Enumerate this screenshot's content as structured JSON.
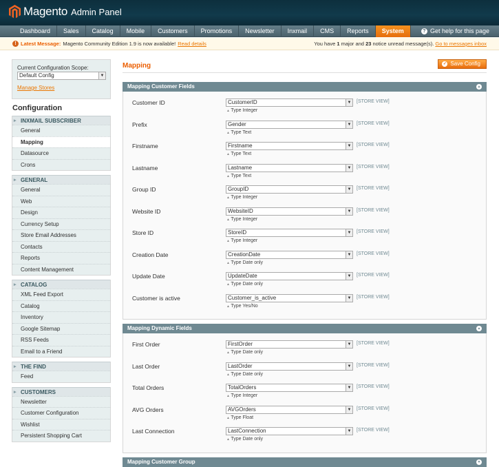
{
  "header": {
    "brand": "Magento",
    "sub": "Admin Panel",
    "help": "Get help for this page"
  },
  "nav": [
    "Dashboard",
    "Sales",
    "Catalog",
    "Mobile",
    "Customers",
    "Promotions",
    "Newsletter",
    "Inxmail",
    "CMS",
    "Reports",
    "System"
  ],
  "nav_active": "System",
  "notice": {
    "strong": "Latest Message:",
    "text": "Magento Community Edition 1.9 is now available!",
    "link": "Read details",
    "right_a": "You have ",
    "major_count": "1",
    "right_b": " major and ",
    "notice_count": "23",
    "right_c": " notice unread message(s). ",
    "right_link": "Go to messages inbox"
  },
  "scope": {
    "label": "Current Configuration Scope:",
    "value": "Default Config",
    "manage": "Manage Stores"
  },
  "config_title": "Configuration",
  "sidebar": [
    {
      "title": "INXMAIL SUBSCRIBER",
      "items": [
        "General",
        "Mapping",
        "Datasource",
        "Crons"
      ]
    },
    {
      "title": "GENERAL",
      "items": [
        "General",
        "Web",
        "Design",
        "Currency Setup",
        "Store Email Addresses",
        "Contacts",
        "Reports",
        "Content Management"
      ]
    },
    {
      "title": "CATALOG",
      "items": [
        "XML Feed Export",
        "Catalog",
        "Inventory",
        "Google Sitemap",
        "RSS Feeds",
        "Email to a Friend"
      ]
    },
    {
      "title": "THE FIND",
      "items": [
        "Feed"
      ]
    },
    {
      "title": "CUSTOMERS",
      "items": [
        "Newsletter",
        "Customer Configuration",
        "Wishlist",
        "Persistent Shopping Cart"
      ]
    }
  ],
  "sidebar_active": "Mapping",
  "page": {
    "title": "Mapping",
    "save": "Save Config"
  },
  "scope_tag": "[STORE VIEW]",
  "fieldsets": [
    {
      "title": "Mapping Customer Fields",
      "collapsed": false,
      "rows": [
        {
          "label": "Customer ID",
          "value": "CustomerID",
          "note": "Type Integer"
        },
        {
          "label": "Prefix",
          "value": "Gender",
          "note": "Type Text"
        },
        {
          "label": "Firstname",
          "value": "Firstname",
          "note": "Type Text"
        },
        {
          "label": "Lastname",
          "value": "Lastname",
          "note": "Type Text"
        },
        {
          "label": "Group ID",
          "value": "GroupID",
          "note": "Type Integer"
        },
        {
          "label": "Website ID",
          "value": "WebsiteID",
          "note": "Type Integer"
        },
        {
          "label": "Store ID",
          "value": "StoreID",
          "note": "Type Integer"
        },
        {
          "label": "Creation Date",
          "value": "CreationDate",
          "note": "Type Date only"
        },
        {
          "label": "Update Date",
          "value": "UpdateDate",
          "note": "Type Date only"
        },
        {
          "label": "Customer is active",
          "value": "Customer_is_active",
          "note": "Type Yes/No"
        }
      ]
    },
    {
      "title": "Mapping Dynamic Fields",
      "collapsed": false,
      "rows": [
        {
          "label": "First Order",
          "value": "FirstOrder",
          "note": "Type Date only"
        },
        {
          "label": "Last Order",
          "value": "LastOrder",
          "note": "Type Date only"
        },
        {
          "label": "Total Orders",
          "value": "TotalOrders",
          "note": "Type Integer"
        },
        {
          "label": "AVG Orders",
          "value": "AVGOrders",
          "note": "Type Float"
        },
        {
          "label": "Last Connection",
          "value": "LastConnection",
          "note": "Type Date only"
        }
      ]
    },
    {
      "title": "Mapping Customer Group",
      "collapsed": true,
      "rows": []
    }
  ],
  "colors": {
    "accent": "#eb5e00",
    "header": "#113a4b",
    "fieldset_head": "#6f8992",
    "sidebar_bg": "#e7efef"
  }
}
